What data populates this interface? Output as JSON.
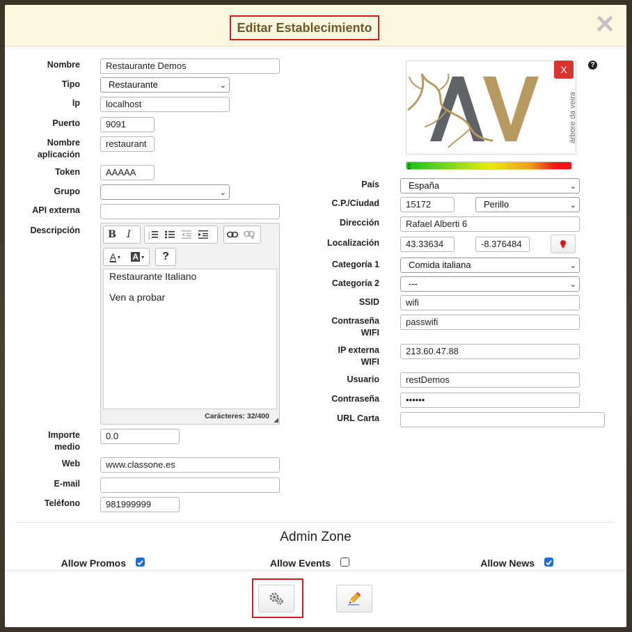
{
  "modal": {
    "title": "Editar Establecimiento",
    "close_glyph": "✕"
  },
  "left_form": {
    "nombre": {
      "label": "Nombre",
      "value": "Restaurante Demos"
    },
    "tipo": {
      "label": "Tipo",
      "value": "Restaurante"
    },
    "ip": {
      "label": "Ip",
      "value": "localhost"
    },
    "puerto": {
      "label": "Puerto",
      "value": "9091"
    },
    "nombre_app": {
      "label_1": "Nombre",
      "label_2": "aplicación",
      "value": "restaurant"
    },
    "token": {
      "label": "Token",
      "value": "AAAAA"
    },
    "grupo": {
      "label": "Grupo",
      "value": ""
    },
    "api_externa": {
      "label": "API externa",
      "value": ""
    },
    "descripcion": {
      "label": "Descripción",
      "lines": [
        "Restaurante Italiano",
        "Ven a probar"
      ],
      "counter": "Carácteres: 32/400",
      "toolbar": {
        "bold": "B",
        "italic": "I",
        "ordered_list_icon": "ordered-list-icon",
        "unordered_list_icon": "unordered-list-icon",
        "outdent_icon": "outdent-icon",
        "indent_icon": "indent-icon",
        "link_icon": "link-icon",
        "unlink_icon": "unlink-icon",
        "font_color": "A",
        "highlight": "A",
        "help": "?"
      }
    },
    "importe": {
      "label_1": "Importe",
      "label_2": "medio",
      "value": "0.0"
    },
    "web": {
      "label": "Web",
      "value": "www.classone.es"
    },
    "email": {
      "label": "E-mail",
      "value": ""
    },
    "telefono": {
      "label": "Teléfono",
      "value": "981999999"
    }
  },
  "right_form": {
    "logo": {
      "remove_label": "X",
      "help": "?",
      "brand_letters": "AV",
      "brand_tagline": "árbore da veira"
    },
    "pais": {
      "label": "País",
      "value": "España"
    },
    "cp_ciudad": {
      "label": "C.P./Ciudad",
      "cp": "15172",
      "ciudad": "Perillo"
    },
    "direccion": {
      "label": "Dirección",
      "value": "Rafael Alberti 6"
    },
    "localizacion": {
      "label": "Localización",
      "lat": "43.33634",
      "lng": "-8.376484"
    },
    "categoria1": {
      "label": "Categoría 1",
      "value": "Comida italiana"
    },
    "categoria2": {
      "label": "Categoría 2",
      "value": "---"
    },
    "ssid": {
      "label": "SSID",
      "value": "wifi"
    },
    "contrasena_wifi": {
      "label_1": "Contraseña",
      "label_2": "WIFI",
      "value": "passwifi"
    },
    "ip_externa": {
      "label_1": "IP externa",
      "label_2": "WIFI",
      "value": "213.60.47.88"
    },
    "usuario": {
      "label": "Usuario",
      "value": "restDemos"
    },
    "contrasena": {
      "label": "Contraseña",
      "value": "••••••"
    },
    "url_carta": {
      "label": "URL Carta",
      "value": ""
    }
  },
  "admin_zone": {
    "title": "Admin Zone",
    "allow_promos": {
      "label": "Allow Promos",
      "checked": true
    },
    "allow_events": {
      "label": "Allow Events",
      "checked": false
    },
    "allow_news": {
      "label": "Allow News",
      "checked": true
    }
  },
  "footer": {
    "settings_icon": "gears-icon",
    "edit_icon": "pencil-icon"
  },
  "colors": {
    "header_bg": "#fcf7e1",
    "title": "#6a5a2a",
    "highlight_border": "#d91a1a",
    "checkbox": "#1a6ed8",
    "remove_button": "#d9342e"
  }
}
